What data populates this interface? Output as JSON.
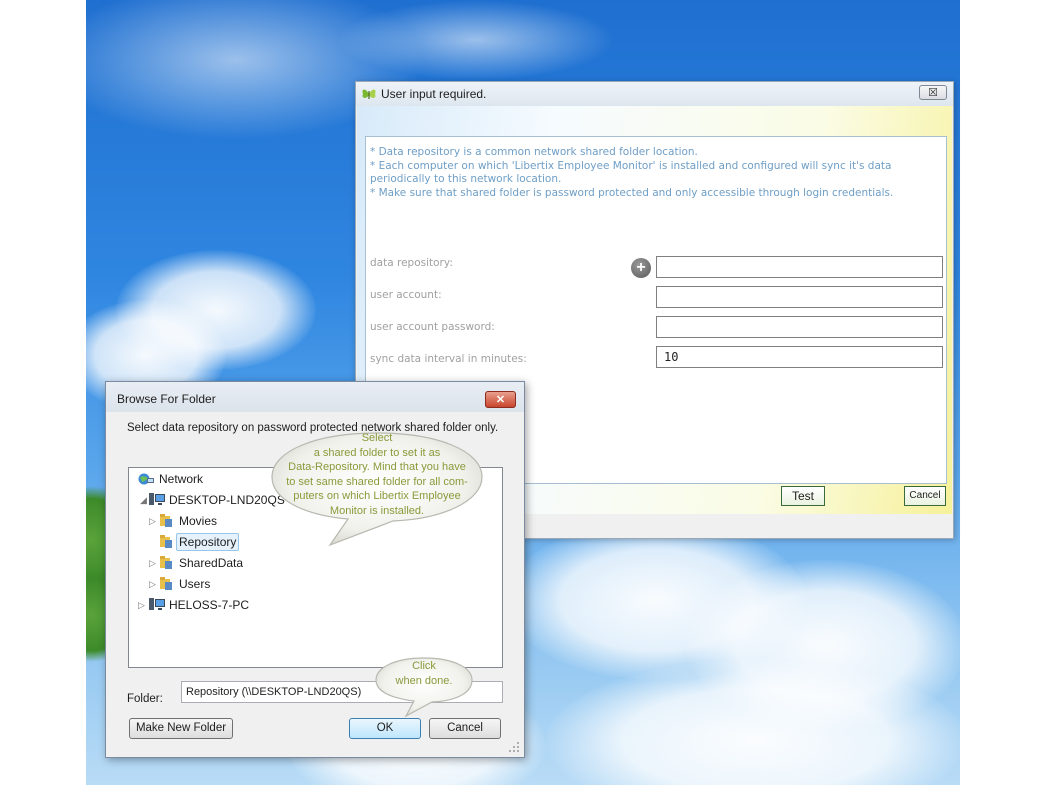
{
  "main_dialog": {
    "title": "User input required.",
    "close_label": "☒",
    "info_lines": [
      "* Data repository is a common network shared folder location.",
      "* Each computer on which 'Libertix Employee Monitor' is installed and configured will sync it's data",
      "periodically to this network location.",
      "* Make sure that shared folder is password protected and only accessible through login credentials."
    ],
    "fields": {
      "data_repository_label": "data repository:",
      "data_repository_value": "",
      "user_account_label": "user account:",
      "user_account_value": "",
      "password_label": "user account password:",
      "password_value": "",
      "sync_interval_label": "sync data interval in minutes:",
      "sync_interval_value": "10"
    },
    "add_icon": "+",
    "test_button": "Test",
    "cancel_button": "Cancel"
  },
  "browse_dialog": {
    "title": "Browse For Folder",
    "close_label": "✕",
    "description": "Select data repository on password protected network shared folder only.",
    "tree": {
      "network": "Network",
      "computer": "DESKTOP-LND20QS",
      "folders": [
        "Movies",
        "Repository",
        "SharedData",
        "Users"
      ],
      "other_computer": "HELOSS-7-PC"
    },
    "folder_label": "Folder:",
    "folder_value": "Repository (\\\\DESKTOP-LND20QS)",
    "make_new_folder": "Make New Folder",
    "ok": "OK",
    "cancel": "Cancel"
  },
  "balloons": {
    "select_lines": [
      "Select",
      "a shared folder to set it as",
      "Data-Repository. Mind that you have",
      "to set same shared folder for all com-",
      "puters on which Libertix Employee",
      "Monitor is installed."
    ],
    "click_lines": [
      "Click",
      "when done."
    ]
  },
  "colors": {
    "info_text": "#6e9ec6",
    "balloon_text": "#8a9a3a",
    "sky": "#2f86e0"
  }
}
